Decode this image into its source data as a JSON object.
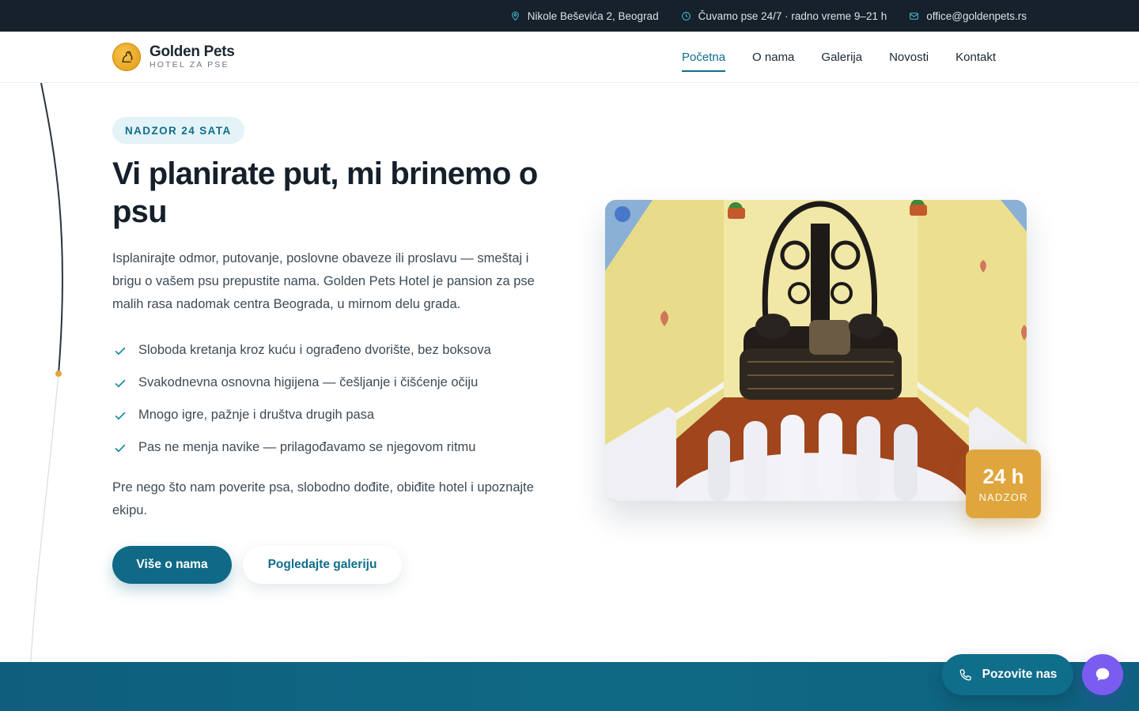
{
  "topbar": {
    "address": "Nikole Beševića 2, Beograd",
    "hours": "Čuvamo pse 24/7 · radno vreme 9–21 h",
    "email": "office@goldenpets.rs"
  },
  "brand": {
    "name": "Golden Pets",
    "tagline": "HOTEL ZA PSE"
  },
  "nav": {
    "items": [
      "Početna",
      "O nama",
      "Galerija",
      "Novosti",
      "Kontakt"
    ],
    "active": "Početna"
  },
  "hero": {
    "badge": "NADZOR 24 SATA",
    "title": "Vi planirate put, mi brinemo o psu",
    "lead": "Isplanirajte odmor, putovanje, poslovne obaveze ili proslavu — smeštaj i brigu o vašem psu prepustite nama. Golden Pets Hotel je pansion za pse malih rasa nadomak centra Beograda, u mirnom delu grada.",
    "features": [
      "Sloboda kretanja kroz kuću i ograđeno dvorište, bez boksova",
      "Svakodnevna osnovna higijena — češljanje i čišćenje očiju",
      "Mnogo igre, pažnje i društva drugih pasa",
      "Pas ne menja navike — prilagođavamo se njegovom ritmu"
    ],
    "note": "Pre nego što nam poverite psa, slobodno dođite, obiđite hotel i upoznajte ekipu.",
    "primary_button": "Više o nama",
    "secondary_button": "Pogledajte galeriju"
  },
  "stat": {
    "value": "24 h",
    "label": "NADZOR"
  },
  "floating": {
    "call_label": "Pozovite nas"
  },
  "colors": {
    "accent": "#0e6e8c",
    "topbar": "#16212b",
    "gold": "#e0a63e",
    "chat": "#7b5cf0"
  },
  "icons": [
    "location-pin-icon",
    "clock-icon",
    "mail-icon",
    "check-icon",
    "phone-icon",
    "chat-bubble-icon"
  ]
}
